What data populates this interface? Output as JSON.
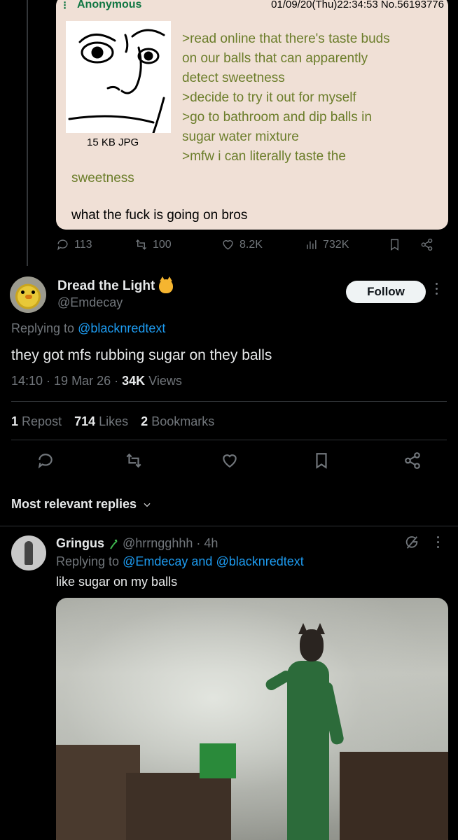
{
  "quoted_post": {
    "greentext": {
      "name": "Anonymous",
      "datetime": "01/09/20(Thu)22:34:53 No.56193776",
      "filesize": "15 KB JPG",
      "lines": [
        ">read online that there's taste buds",
        "on our balls that can apparently",
        "detect sweetness",
        ">decide to try it out for myself",
        ">go to bathroom and dip balls in",
        "sugar water mixture",
        ">mfw i can literally taste the"
      ],
      "line_continued": "sweetness",
      "normal_text": "what the fuck is going on bros"
    },
    "actions": {
      "replies": "113",
      "reposts": "100",
      "likes": "8.2K",
      "views": "732K"
    }
  },
  "main_tweet": {
    "display_name": "Dread the Light",
    "handle": "@Emdecay",
    "follow_label": "Follow",
    "replying_prefix": "Replying to",
    "replying_to": "@blacknredtext",
    "text": "they got mfs rubbing sugar on they balls",
    "timestamp": "14:10 · 19 Mar 26 · ",
    "views_count": "34K",
    "views_label": "Views",
    "stats": {
      "reposts_count": "1",
      "reposts_label": "Repost",
      "likes_count": "714",
      "likes_label": "Likes",
      "bookmarks_count": "2",
      "bookmarks_label": "Bookmarks"
    }
  },
  "replies_sort": {
    "label": "Most relevant replies"
  },
  "reply": {
    "display_name": "Gringus",
    "handle": "@hrrngghhh · 4h",
    "replying_prefix": "Replying to",
    "mention_1": "@Emdecay",
    "and_word": "and",
    "mention_2": "@blacknredtext",
    "text": "like sugar on my balls"
  },
  "colors": {
    "background": "#000000",
    "text_primary": "#e7e9ea",
    "text_secondary": "#71767b",
    "link": "#1d9bf0",
    "greentext": "#6b7d2a",
    "card_bg": "#f0e0d6"
  }
}
